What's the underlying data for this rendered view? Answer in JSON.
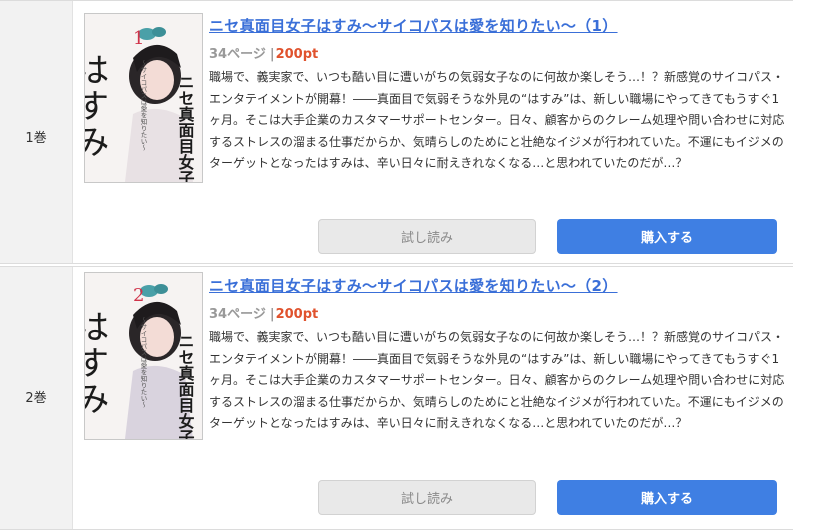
{
  "colors": {
    "link": "#3a6fd8",
    "price": "#e0522d",
    "buy_button": "#3f7fe3",
    "trial_button": "#e9e9e9",
    "volume_cell": "#f2f2f2"
  },
  "volumes": [
    {
      "volume_label": "1巻",
      "cover": {
        "title_vertical": "はすみ",
        "series_mark": "ニセ真面目女子",
        "number": "1",
        "subtitle": "〜サイコパスは愛を知りたい〜",
        "icon": "manga-cover-image"
      },
      "title": "ニセ真面目女子はすみ～サイコパスは愛を知りたい～（1）",
      "pages": "34ページ",
      "separator": "|",
      "price": "200pt",
      "description": "職場で、義実家で、いつも酷い目に遭いがちの気弱女子なのに何故か楽しそう…！？新感覚のサイコパス・エンタテイメントが開幕！――真面目で気弱そうな外見の“はすみ”は、新しい職場にやってきてもうすぐ1ヶ月。そこは大手企業のカスタマーサポートセンター。日々、顧客からのクレーム処理や問い合わせに対応するストレスの溜まる仕事だからか、気晴らしのためにと壮絶なイジメが行われていた。不運にもイジメのターゲットとなったはすみは、辛い日々に耐えきれなくなる…と思われていたのだが…？",
      "trial_label": "試し読み",
      "buy_label": "購入する"
    },
    {
      "volume_label": "2巻",
      "cover": {
        "title_vertical": "はすみ",
        "series_mark": "ニセ真面目女子",
        "number": "2",
        "subtitle": "〜サイコパスは愛を知りたい〜",
        "icon": "manga-cover-image"
      },
      "title": "ニセ真面目女子はすみ～サイコパスは愛を知りたい～（2）",
      "pages": "34ページ",
      "separator": "|",
      "price": "200pt",
      "description": "職場で、義実家で、いつも酷い目に遭いがちの気弱女子なのに何故か楽しそう…！？新感覚のサイコパス・エンタテイメントが開幕！――真面目で気弱そうな外見の“はすみ”は、新しい職場にやってきてもうすぐ1ヶ月。そこは大手企業のカスタマーサポートセンター。日々、顧客からのクレーム処理や問い合わせに対応するストレスの溜まる仕事だからか、気晴らしのためにと壮絶なイジメが行われていた。不運にもイジメのターゲットとなったはすみは、辛い日々に耐えきれなくなる…と思われていたのだが…？",
      "trial_label": "試し読み",
      "buy_label": "購入する"
    }
  ]
}
